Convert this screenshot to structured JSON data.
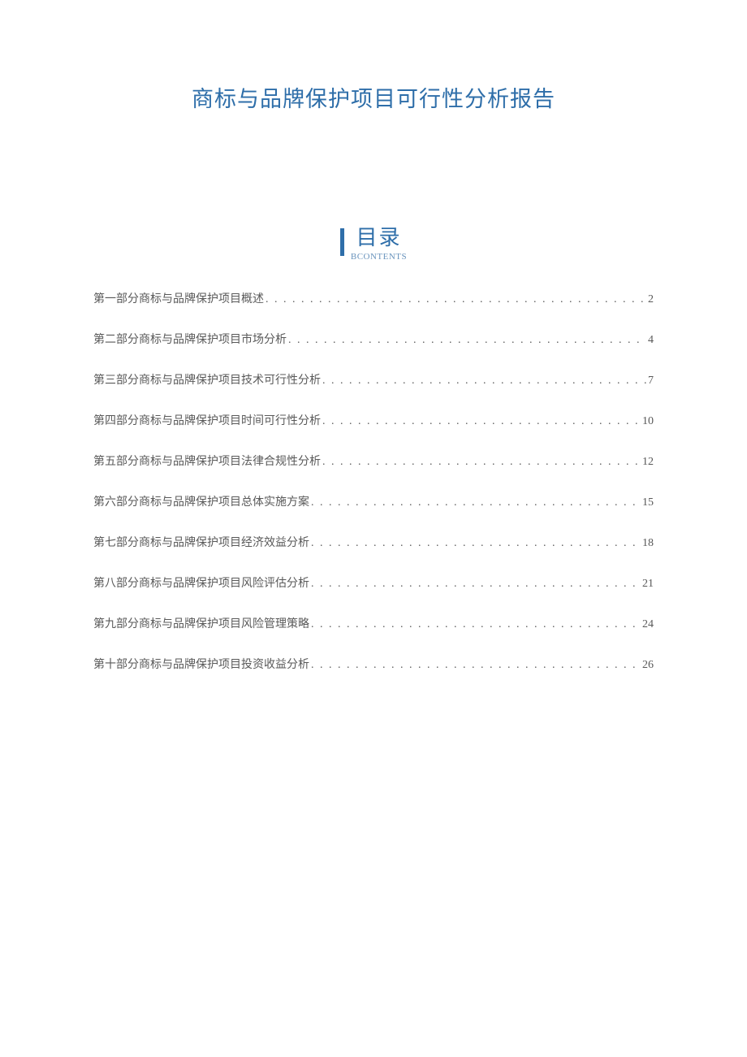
{
  "document": {
    "title": "商标与品牌保护项目可行性分析报告"
  },
  "toc": {
    "heading_cn": "目录",
    "heading_en": "BCONTENTS",
    "items": [
      {
        "label": "第一部分商标与品牌保护项目概述",
        "page": "2"
      },
      {
        "label": "第二部分商标与品牌保护项目市场分析",
        "page": "4"
      },
      {
        "label": "第三部分商标与品牌保护项目技术可行性分析",
        "page": "7"
      },
      {
        "label": "第四部分商标与品牌保护项目时间可行性分析",
        "page": "10"
      },
      {
        "label": "第五部分商标与品牌保护项目法律合规性分析",
        "page": "12"
      },
      {
        "label": "第六部分商标与品牌保护项目总体实施方案",
        "page": "15"
      },
      {
        "label": "第七部分商标与品牌保护项目经济效益分析",
        "page": "18"
      },
      {
        "label": "第八部分商标与品牌保护项目风险评估分析",
        "page": "21"
      },
      {
        "label": "第九部分商标与品牌保护项目风险管理策略",
        "page": "24"
      },
      {
        "label": "第十部分商标与品牌保护项目投资收益分析",
        "page": "26"
      }
    ]
  }
}
